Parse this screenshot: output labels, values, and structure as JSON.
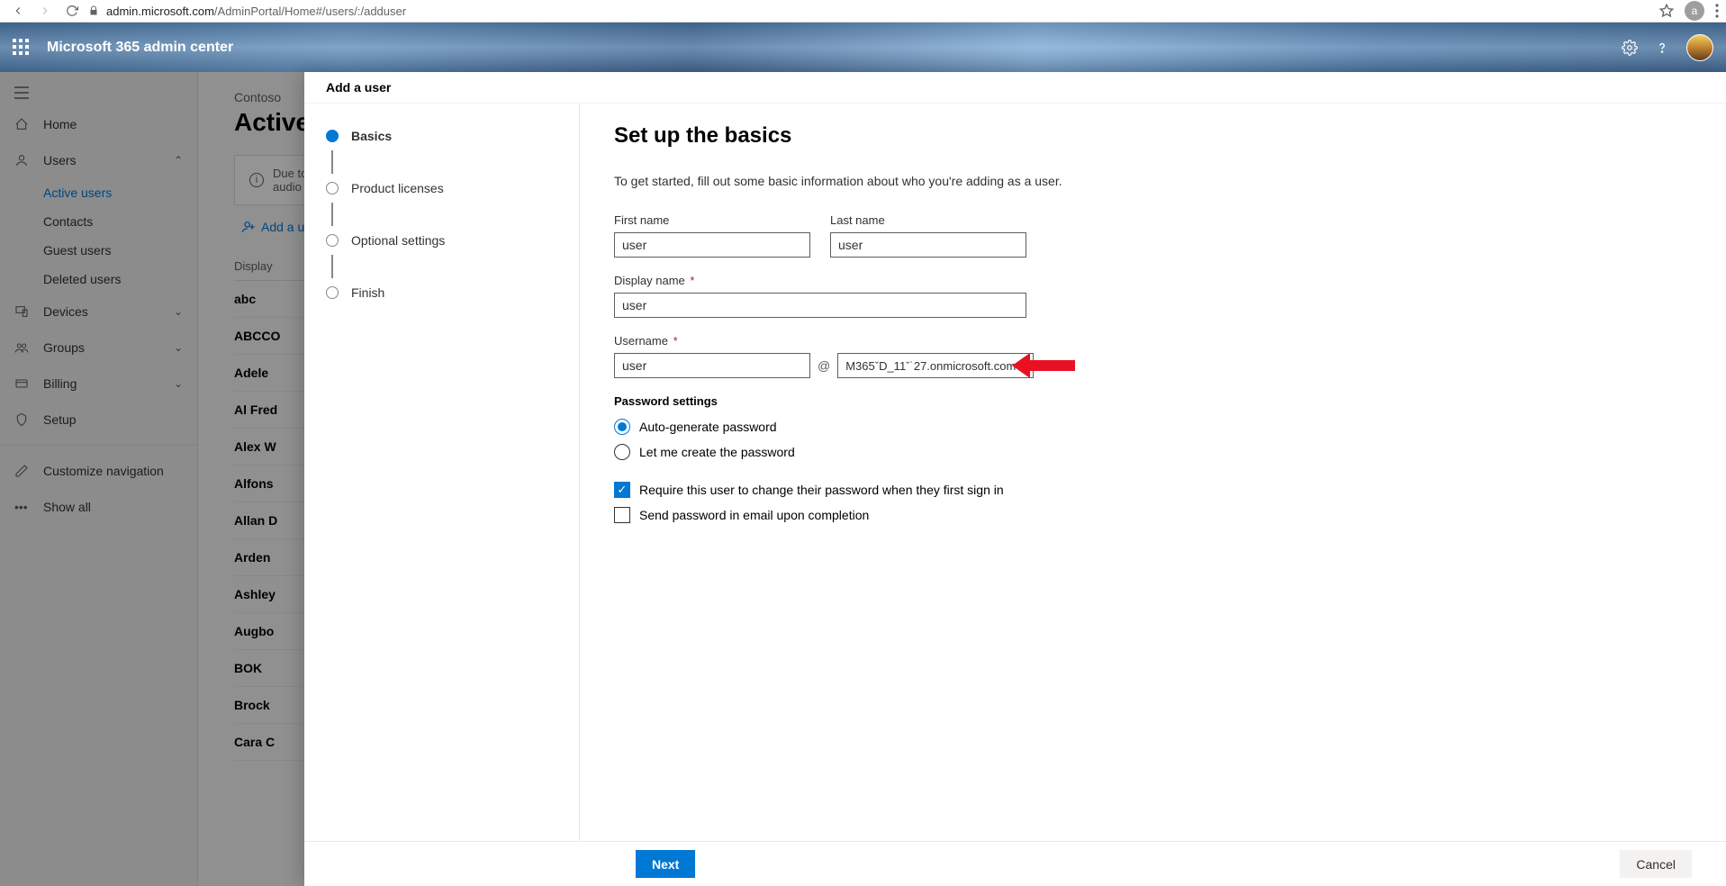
{
  "browser": {
    "url_host": "admin.microsoft.com",
    "url_path": "/AdminPortal/Home#/users/:/adduser",
    "avatar_initial": "a"
  },
  "suite": {
    "title": "Microsoft 365 admin center"
  },
  "nav": {
    "home": "Home",
    "users": "Users",
    "users_sub": {
      "active": "Active users",
      "contacts": "Contacts",
      "guest": "Guest users",
      "deleted": "Deleted users"
    },
    "devices": "Devices",
    "groups": "Groups",
    "billing": "Billing",
    "setup": "Setup",
    "customize": "Customize navigation",
    "showall": "Show all"
  },
  "page": {
    "org": "Contoso",
    "title": "Active u",
    "banner": "Due to a rec\naudio confe",
    "add_user": "Add a user",
    "col_header": "Display",
    "rows": [
      "abc",
      "ABCCO",
      "Adele",
      "Al Fred",
      "Alex W",
      "Alfons",
      "Allan D",
      "Arden",
      "Ashley",
      "Augbo",
      "BOK",
      "Brock",
      "Cara C"
    ]
  },
  "wizard": {
    "title": "Add a user",
    "steps": [
      "Basics",
      "Product licenses",
      "Optional settings",
      "Finish"
    ],
    "form": {
      "heading": "Set up the basics",
      "description": "To get started, fill out some basic information about who you're adding as a user.",
      "first_name_label": "First name",
      "first_name_value": "user",
      "last_name_label": "Last name",
      "last_name_value": "user",
      "display_name_label": "Display name",
      "display_name_value": "user",
      "username_label": "Username",
      "username_value": "user",
      "domain_value": "M365ˇD_11ˇ˙27.onmicrosoft.com",
      "password_section": "Password settings",
      "pw_auto": "Auto-generate password",
      "pw_manual": "Let me create the password",
      "chk_change": "Require this user to change their password when they first sign in",
      "chk_email": "Send password in email upon completion"
    },
    "footer": {
      "next": "Next",
      "cancel": "Cancel"
    }
  }
}
